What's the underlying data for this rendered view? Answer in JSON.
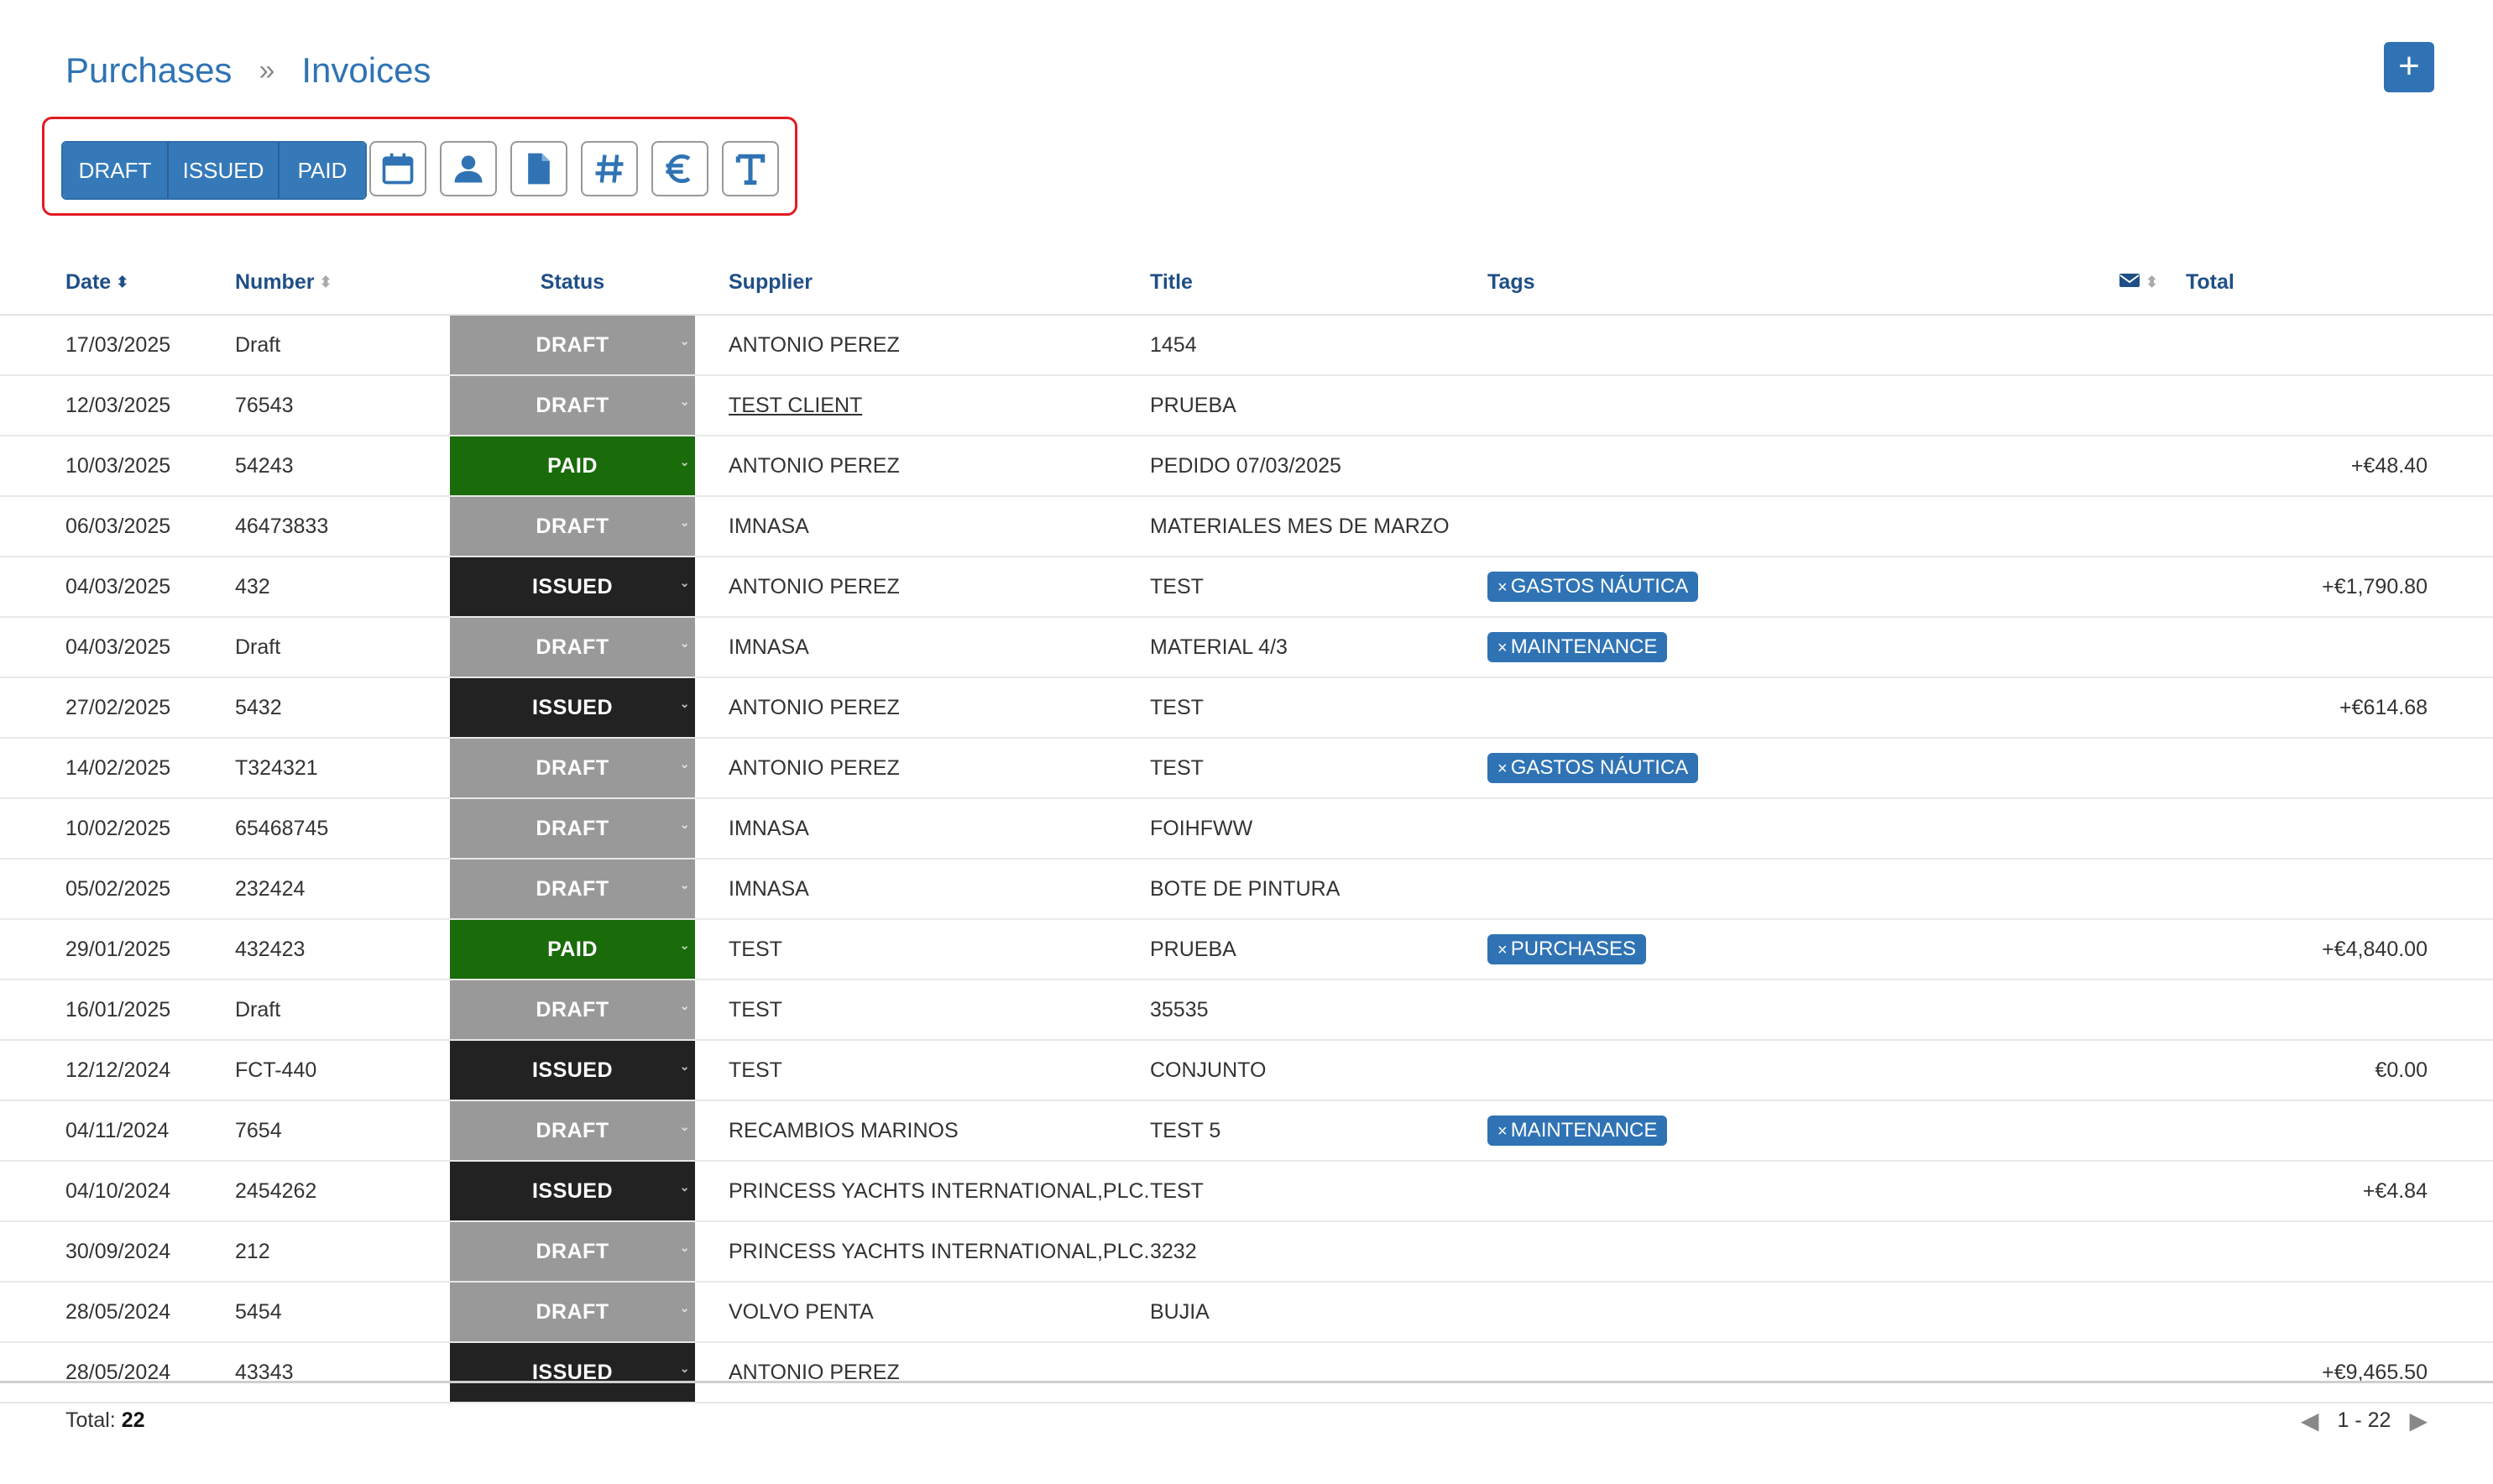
{
  "breadcrumb": {
    "parent": "Purchases",
    "separator": "»",
    "current": "Invoices"
  },
  "add_button": {
    "icon": "plus-icon",
    "label": "+"
  },
  "filters": {
    "status_buttons": [
      "DRAFT",
      "ISSUED",
      "PAID"
    ],
    "icons": [
      "calendar-icon",
      "person-icon",
      "document-icon",
      "hash-icon",
      "euro-icon",
      "text-icon"
    ],
    "accent": "#3579b9"
  },
  "columns": {
    "date": "Date",
    "number": "Number",
    "status": "Status",
    "supplier": "Supplier",
    "title": "Title",
    "tags": "Tags",
    "mail": "envelope-icon",
    "total": "Total"
  },
  "status_colors": {
    "DRAFT": "#999999",
    "PAID": "#1a6b0a",
    "ISSUED": "#222222"
  },
  "rows": [
    {
      "date": "17/03/2025",
      "number": "Draft",
      "status": "DRAFT",
      "supplier": "ANTONIO PEREZ",
      "title": "1454",
      "tag": "",
      "total": ""
    },
    {
      "date": "12/03/2025",
      "number": "76543",
      "status": "DRAFT",
      "supplier": "TEST CLIENT",
      "title": "PRUEBA",
      "tag": "",
      "total": ""
    },
    {
      "date": "10/03/2025",
      "number": "54243",
      "status": "PAID",
      "supplier": "ANTONIO PEREZ",
      "title": "PEDIDO 07/03/2025",
      "tag": "",
      "total": "+€48.40"
    },
    {
      "date": "06/03/2025",
      "number": "46473833",
      "status": "DRAFT",
      "supplier": "IMNASA",
      "title": "MATERIALES MES DE MARZO",
      "tag": "",
      "total": ""
    },
    {
      "date": "04/03/2025",
      "number": "432",
      "status": "ISSUED",
      "supplier": "ANTONIO PEREZ",
      "title": "TEST",
      "tag": "GASTOS NÁUTICA",
      "total": "+€1,790.80"
    },
    {
      "date": "04/03/2025",
      "number": "Draft",
      "status": "DRAFT",
      "supplier": "IMNASA",
      "title": "MATERIAL 4/3",
      "tag": "MAINTENANCE",
      "total": ""
    },
    {
      "date": "27/02/2025",
      "number": "5432",
      "status": "ISSUED",
      "supplier": "ANTONIO PEREZ",
      "title": "TEST",
      "tag": "",
      "total": "+€614.68"
    },
    {
      "date": "14/02/2025",
      "number": "T324321",
      "status": "DRAFT",
      "supplier": "ANTONIO PEREZ",
      "title": "TEST",
      "tag": "GASTOS NÁUTICA",
      "total": ""
    },
    {
      "date": "10/02/2025",
      "number": "65468745",
      "status": "DRAFT",
      "supplier": "IMNASA",
      "title": "FOIHFWW",
      "tag": "",
      "total": ""
    },
    {
      "date": "05/02/2025",
      "number": "232424",
      "status": "DRAFT",
      "supplier": "IMNASA",
      "title": "BOTE DE PINTURA",
      "tag": "",
      "total": ""
    },
    {
      "date": "29/01/2025",
      "number": "432423",
      "status": "PAID",
      "supplier": "TEST",
      "title": "PRUEBA",
      "tag": "PURCHASES",
      "total": "+€4,840.00"
    },
    {
      "date": "16/01/2025",
      "number": "Draft",
      "status": "DRAFT",
      "supplier": "TEST",
      "title": "35535",
      "tag": "",
      "total": ""
    },
    {
      "date": "12/12/2024",
      "number": "FCT-440",
      "status": "ISSUED",
      "supplier": "TEST",
      "title": "CONJUNTO",
      "tag": "",
      "total": "€0.00"
    },
    {
      "date": "04/11/2024",
      "number": "7654",
      "status": "DRAFT",
      "supplier": "RECAMBIOS MARINOS",
      "title": "TEST 5",
      "tag": "MAINTENANCE",
      "total": ""
    },
    {
      "date": "04/10/2024",
      "number": "2454262",
      "status": "ISSUED",
      "supplier": "PRINCESS YACHTS INTERNATIONAL,PLC.",
      "title": "TEST",
      "tag": "",
      "total": "+€4.84"
    },
    {
      "date": "30/09/2024",
      "number": "212",
      "status": "DRAFT",
      "supplier": "PRINCESS YACHTS INTERNATIONAL,PLC.",
      "title": "3232",
      "tag": "",
      "total": ""
    },
    {
      "date": "28/05/2024",
      "number": "5454",
      "status": "DRAFT",
      "supplier": "VOLVO PENTA",
      "title": "BUJIA",
      "tag": "",
      "total": ""
    },
    {
      "date": "28/05/2024",
      "number": "43343",
      "status": "ISSUED",
      "supplier": "ANTONIO PEREZ",
      "title": "",
      "tag": "",
      "total": "+€9,465.50"
    }
  ],
  "footer": {
    "total_label": "Total:",
    "total_count": "22",
    "range": "1 - 22"
  }
}
